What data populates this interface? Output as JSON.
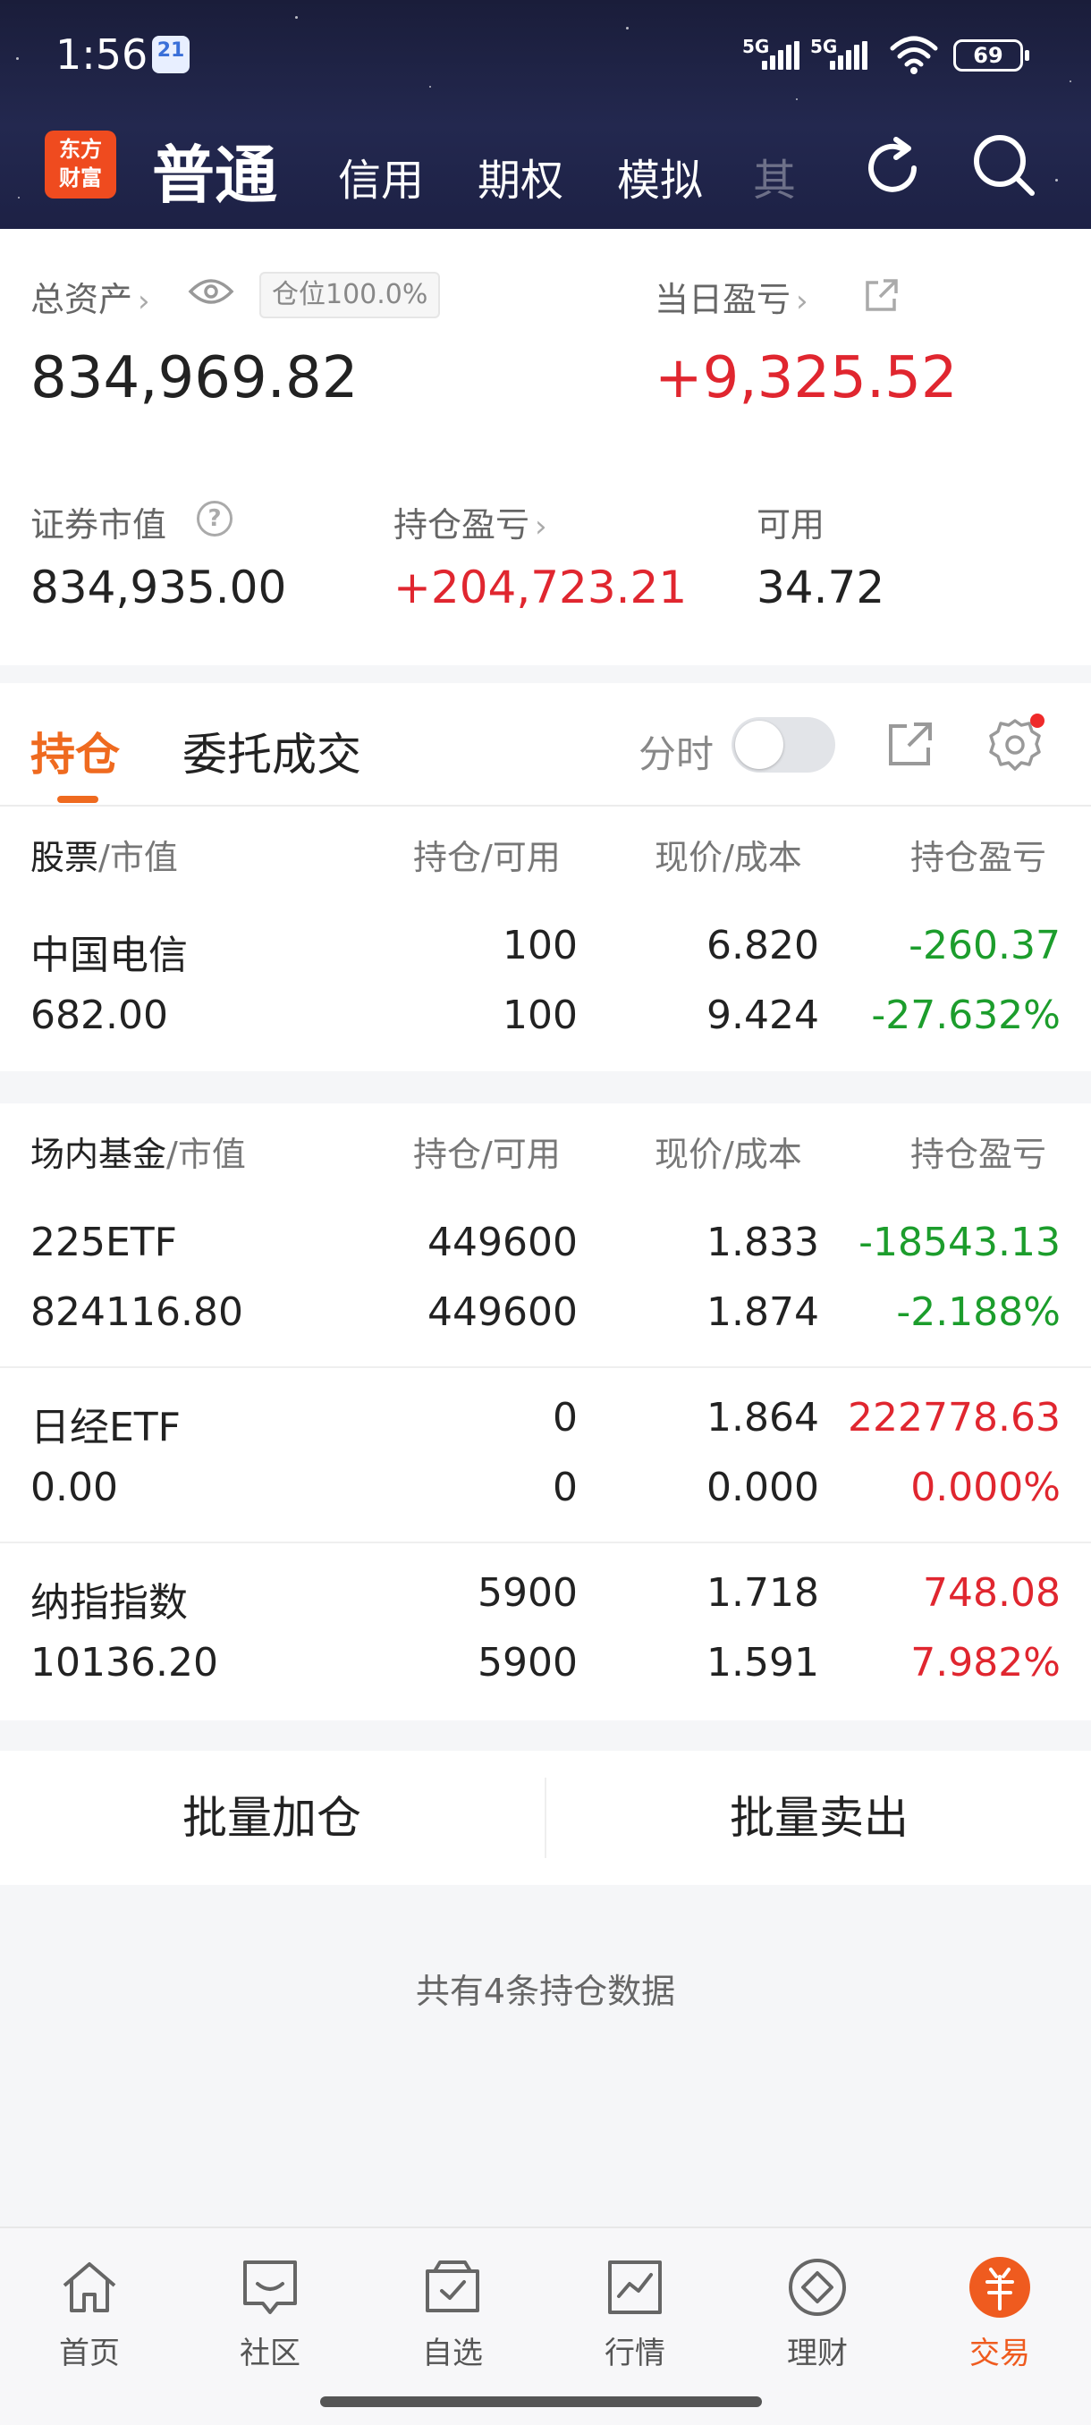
{
  "status_bar": {
    "time": "1:56",
    "notification_badge": "21",
    "signal_1": "5G",
    "signal_2": "5G",
    "battery": "69"
  },
  "header": {
    "logo_line1": "东方",
    "logo_line2": "财富",
    "tabs": [
      "普通",
      "信用",
      "期权",
      "模拟",
      "其"
    ],
    "active_tab": "普通"
  },
  "assets": {
    "total_label": "总资产",
    "position_badge": "仓位100.0%",
    "total_value": "834,969.82",
    "daily_pnl_label": "当日盈亏",
    "daily_pnl_value": "+9,325.52",
    "market_value_label": "证券市值",
    "market_value": "834,935.00",
    "holding_pnl_label": "持仓盈亏",
    "holding_pnl_value": "+204,723.21",
    "available_label": "可用",
    "available_value": "34.72"
  },
  "holdings_tabs": {
    "active": "持仓",
    "other": "委托成交",
    "timeshare_label": "分时",
    "timeshare_on": false
  },
  "stocks_section": {
    "head_name": "股票",
    "head_name_suffix": "/市值",
    "head_qty": "持仓/可用",
    "head_price": "现价/成本",
    "head_pnl": "持仓盈亏",
    "rows": [
      {
        "name": "中国电信",
        "value": "682.00",
        "qty": "100",
        "avail": "100",
        "price": "6.820",
        "cost": "9.424",
        "pnl": "-260.37",
        "pnl_pct": "-27.632%",
        "color": "#1c9d2c"
      }
    ]
  },
  "funds_section": {
    "head_name": "场内基金",
    "head_name_suffix": "/市值",
    "head_qty": "持仓/可用",
    "head_price": "现价/成本",
    "head_pnl": "持仓盈亏",
    "rows": [
      {
        "name": "225ETF",
        "value": "824116.80",
        "qty": "449600",
        "avail": "449600",
        "price": "1.833",
        "cost": "1.874",
        "pnl": "-18543.13",
        "pnl_pct": "-2.188%",
        "color": "#1c9d2c"
      },
      {
        "name": "日经ETF",
        "value": "0.00",
        "qty": "0",
        "avail": "0",
        "price": "1.864",
        "cost": "0.000",
        "pnl": "222778.63",
        "pnl_pct": "0.000%",
        "color": "#e0262f"
      },
      {
        "name": "纳指指数",
        "value": "10136.20",
        "qty": "5900",
        "avail": "5900",
        "price": "1.718",
        "cost": "1.591",
        "pnl": "748.08",
        "pnl_pct": "7.982%",
        "color": "#e0262f"
      }
    ]
  },
  "actions": {
    "batch_add": "批量加仓",
    "batch_sell": "批量卖出"
  },
  "summary_text": "共有4条持仓数据",
  "bottom_nav": [
    {
      "label": "首页",
      "icon": "home-icon"
    },
    {
      "label": "社区",
      "icon": "community-icon"
    },
    {
      "label": "自选",
      "icon": "watchlist-icon"
    },
    {
      "label": "行情",
      "icon": "market-icon"
    },
    {
      "label": "理财",
      "icon": "wealth-icon"
    },
    {
      "label": "交易",
      "icon": "trade-icon"
    }
  ],
  "colors": {
    "accent": "#ef6a1f",
    "up": "#e0262f",
    "down": "#1c9d2c",
    "header_bg": "#1d2145"
  }
}
